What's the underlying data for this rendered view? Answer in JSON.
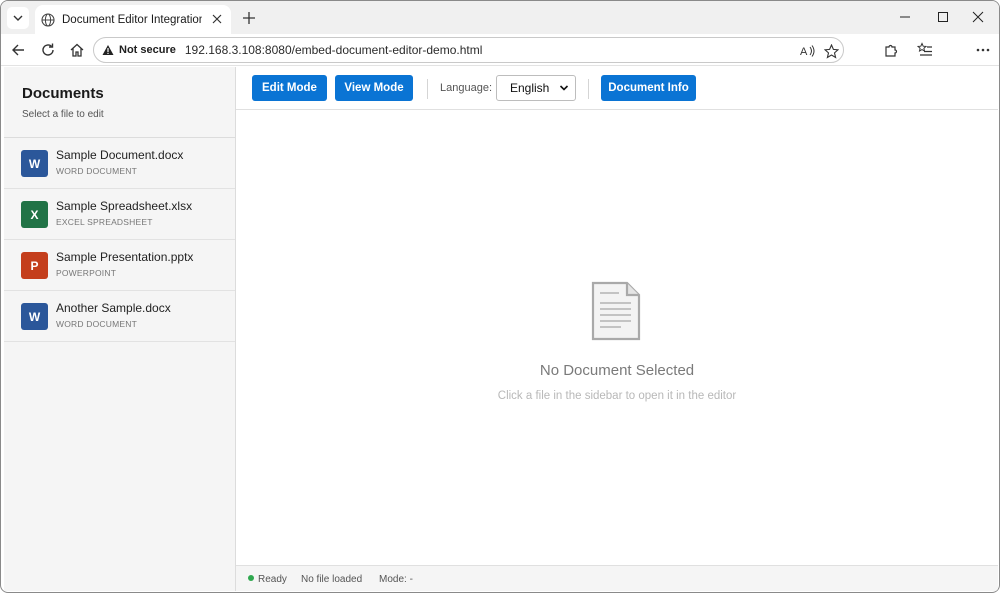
{
  "browser": {
    "tab_title": "Document Editor Integration Demo",
    "security_label": "Not secure",
    "url": "192.168.3.108:8080/embed-document-editor-demo.html"
  },
  "sidebar": {
    "title": "Documents",
    "subtitle": "Select a file to edit",
    "files": [
      {
        "icon_letter": "W",
        "name": "Sample Document.docx",
        "type": "WORD DOCUMENT",
        "color": "#2b579a"
      },
      {
        "icon_letter": "X",
        "name": "Sample Spreadsheet.xlsx",
        "type": "EXCEL SPREADSHEET",
        "color": "#217346"
      },
      {
        "icon_letter": "P",
        "name": "Sample Presentation.pptx",
        "type": "POWERPOINT",
        "color": "#c43e1c"
      },
      {
        "icon_letter": "W",
        "name": "Another Sample.docx",
        "type": "WORD DOCUMENT",
        "color": "#2b579a"
      }
    ]
  },
  "toolbar": {
    "edit_mode": "Edit Mode",
    "view_mode": "View Mode",
    "language_label": "Language:",
    "language_value": "English",
    "document_info": "Document Info",
    "accent_color": "#0a74d4"
  },
  "empty_state": {
    "title": "No Document Selected",
    "subtitle": "Click a file in the sidebar to open it in the editor"
  },
  "status": {
    "state": "Ready",
    "file": "No file loaded",
    "mode": "Mode: -"
  }
}
